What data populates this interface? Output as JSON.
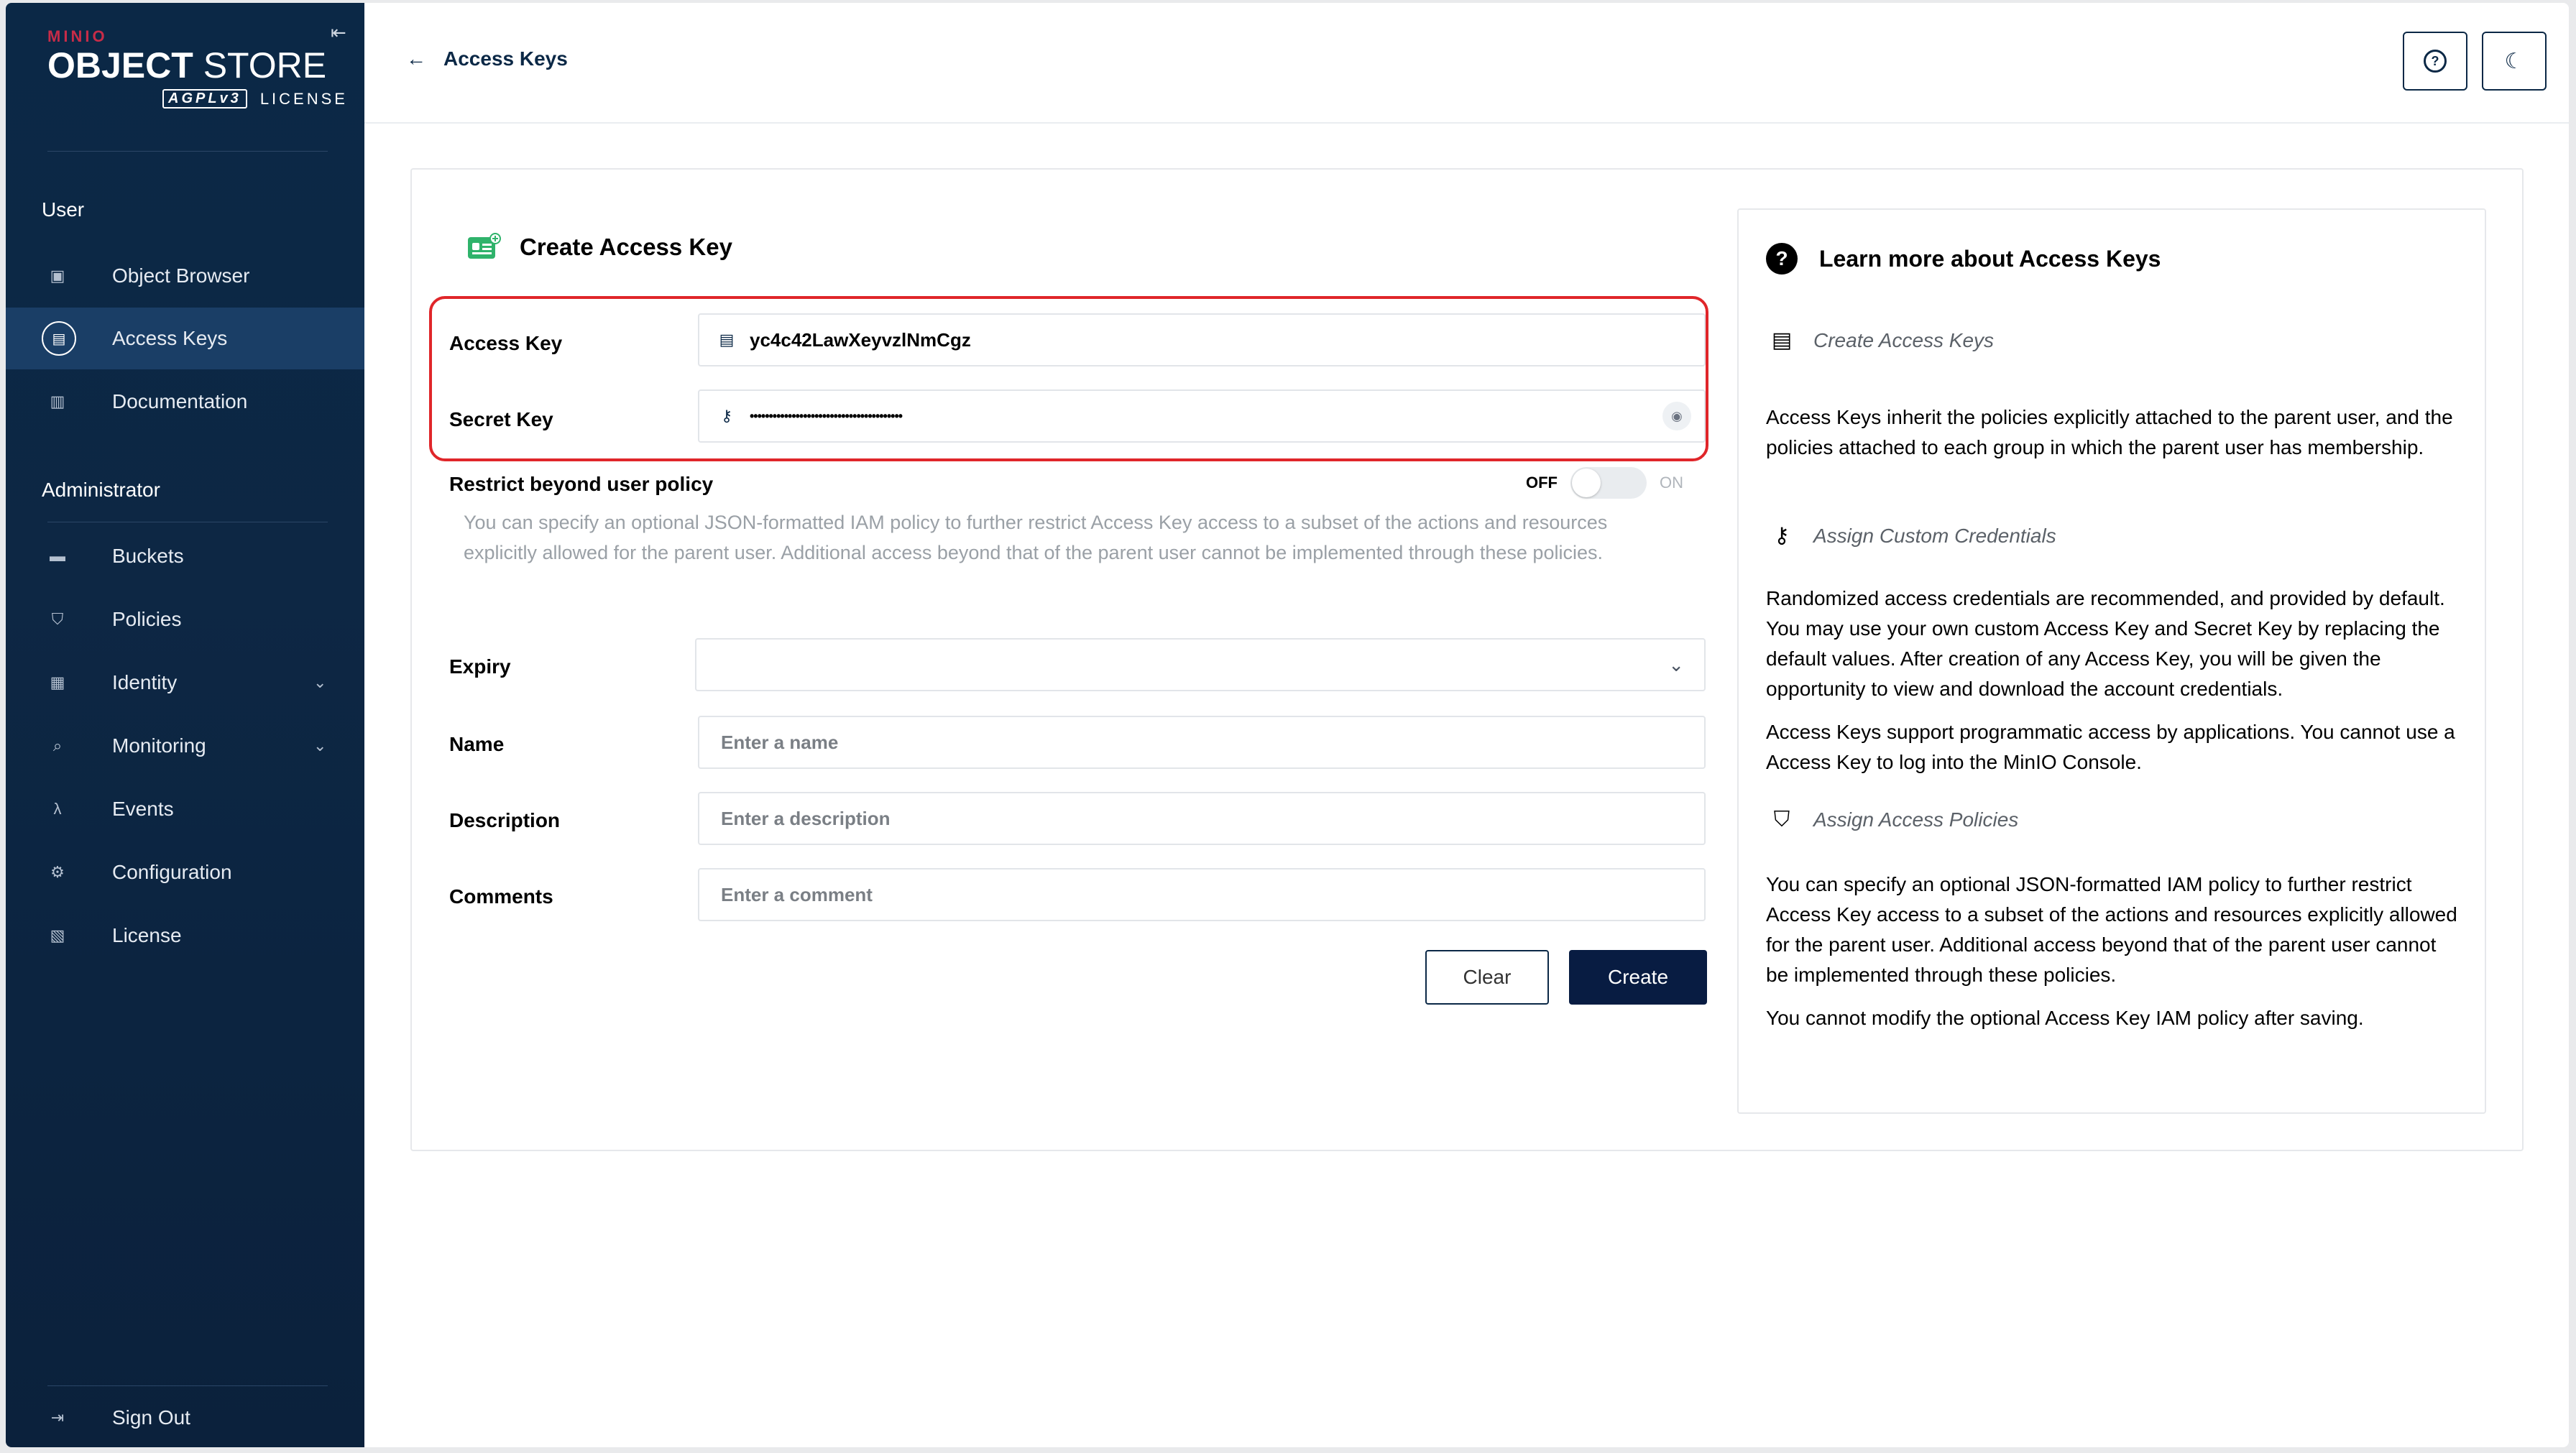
{
  "sidebar": {
    "logo": {
      "brand": "MINIO",
      "product_bold": "OBJECT",
      "product_light": " STORE",
      "license_badge": "AGPLv3",
      "license_text": "LICENSE"
    },
    "user_section": "User",
    "user_items": [
      {
        "label": "Object Browser",
        "icon": "object-browser-icon"
      },
      {
        "label": "Access Keys",
        "icon": "access-keys-icon"
      },
      {
        "label": "Documentation",
        "icon": "documentation-icon"
      }
    ],
    "admin_section": "Administrator",
    "admin_items": [
      {
        "label": "Buckets",
        "icon": "buckets-icon"
      },
      {
        "label": "Policies",
        "icon": "policies-icon"
      },
      {
        "label": "Identity",
        "icon": "identity-icon"
      },
      {
        "label": "Monitoring",
        "icon": "monitoring-icon"
      },
      {
        "label": "Events",
        "icon": "lambda-icon"
      },
      {
        "label": "Configuration",
        "icon": "gear-icon"
      },
      {
        "label": "License",
        "icon": "license-icon"
      }
    ],
    "sign_out": "Sign Out"
  },
  "header": {
    "back_label": "Access Keys"
  },
  "form": {
    "title": "Create Access Key",
    "access_key_label": "Access Key",
    "access_key_value": "yc4c42LawXeyvzlNmCgz",
    "secret_key_label": "Secret Key",
    "secret_key_value": "••••••••••••••••••••••••••••••••••••••••",
    "restrict_label": "Restrict beyond user policy",
    "toggle_off": "OFF",
    "toggle_on": "ON",
    "toggle_enabled": false,
    "restrict_description": "You can specify an optional JSON-formatted IAM policy to further restrict Access Key access to a subset of the actions and resources explicitly allowed for the parent user. Additional access beyond that of the parent user cannot be implemented through these policies.",
    "expiry_label": "Expiry",
    "expiry_value": "",
    "name_label": "Name",
    "name_placeholder": "Enter a name",
    "description_label": "Description",
    "description_placeholder": "Enter a description",
    "comments_label": "Comments",
    "comments_placeholder": "Enter a comment",
    "clear_button": "Clear",
    "create_button": "Create"
  },
  "help": {
    "title": "Learn more about Access Keys",
    "sections": [
      {
        "heading": "Create Access Keys",
        "icon": "id-card-icon"
      },
      {
        "heading": "Assign Custom Credentials",
        "icon": "key-icon"
      },
      {
        "heading": "Assign Access Policies",
        "icon": "shield-icon"
      }
    ],
    "paragraphs": [
      "Access Keys inherit the policies explicitly attached to the parent user, and the policies attached to each group in which the parent user has membership.",
      "Randomized access credentials are recommended, and provided by default. You may use your own custom Access Key and Secret Key by replacing the default values. After creation of any Access Key, you will be given the opportunity to view and download the account credentials.",
      "Access Keys support programmatic access by applications. You cannot use a Access Key to log into the MinIO Console.",
      "You can specify an optional JSON-formatted IAM policy to further restrict Access Key access to a subset of the actions and resources explicitly allowed for the parent user. Additional access beyond that of the parent user cannot be implemented through these policies.",
      "You cannot modify the optional Access Key IAM policy after saving."
    ]
  },
  "colors": {
    "sidebar_bg": "#0b2846",
    "sidebar_active": "#1a3e66",
    "primary_button": "#081c42",
    "highlight_border": "#e0262a",
    "brand_red": "#c72c48",
    "title_icon_green": "#2fb36b"
  }
}
